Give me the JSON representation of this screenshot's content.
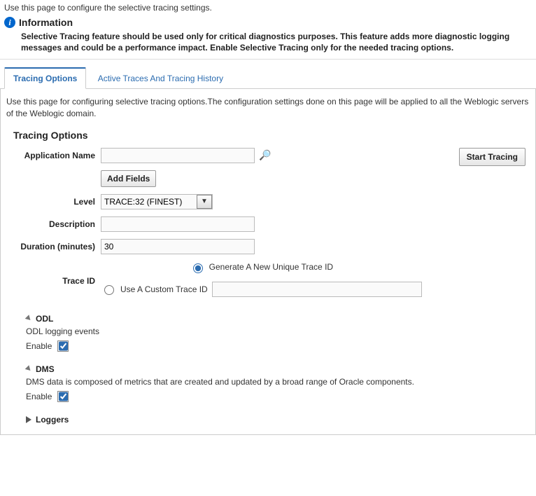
{
  "intro": "Use this page to configure the selective tracing settings.",
  "info": {
    "title": "Information",
    "body": "Selective Tracing feature should be used only for critical diagnostics purposes. This feature adds more diagnostic logging messages and could be a performance impact. Enable Selective Tracing only for the needed tracing options."
  },
  "tabs": {
    "options": "Tracing Options",
    "history": "Active Traces And Tracing History"
  },
  "tabDesc": "Use this page for configuring selective tracing options.The configuration settings done on this page will be applied to all the Weblogic servers of the Weblogic domain.",
  "section": {
    "title": "Tracing Options"
  },
  "buttons": {
    "start": "Start Tracing",
    "addFields": "Add Fields"
  },
  "form": {
    "appName": {
      "label": "Application Name",
      "value": ""
    },
    "level": {
      "label": "Level",
      "value": "TRACE:32 (FINEST)"
    },
    "description": {
      "label": "Description",
      "value": ""
    },
    "duration": {
      "label": "Duration (minutes)",
      "value": "30"
    },
    "traceId": {
      "label": "Trace ID",
      "optGenerate": "Generate A New Unique Trace ID",
      "optCustom": "Use A Custom Trace ID",
      "customValue": ""
    }
  },
  "odl": {
    "title": "ODL",
    "desc": "ODL logging events",
    "enableLabel": "Enable"
  },
  "dms": {
    "title": "DMS",
    "desc": "DMS data is composed of metrics that are created and updated by a broad range of Oracle components.",
    "enableLabel": "Enable"
  },
  "loggers": {
    "title": "Loggers"
  }
}
